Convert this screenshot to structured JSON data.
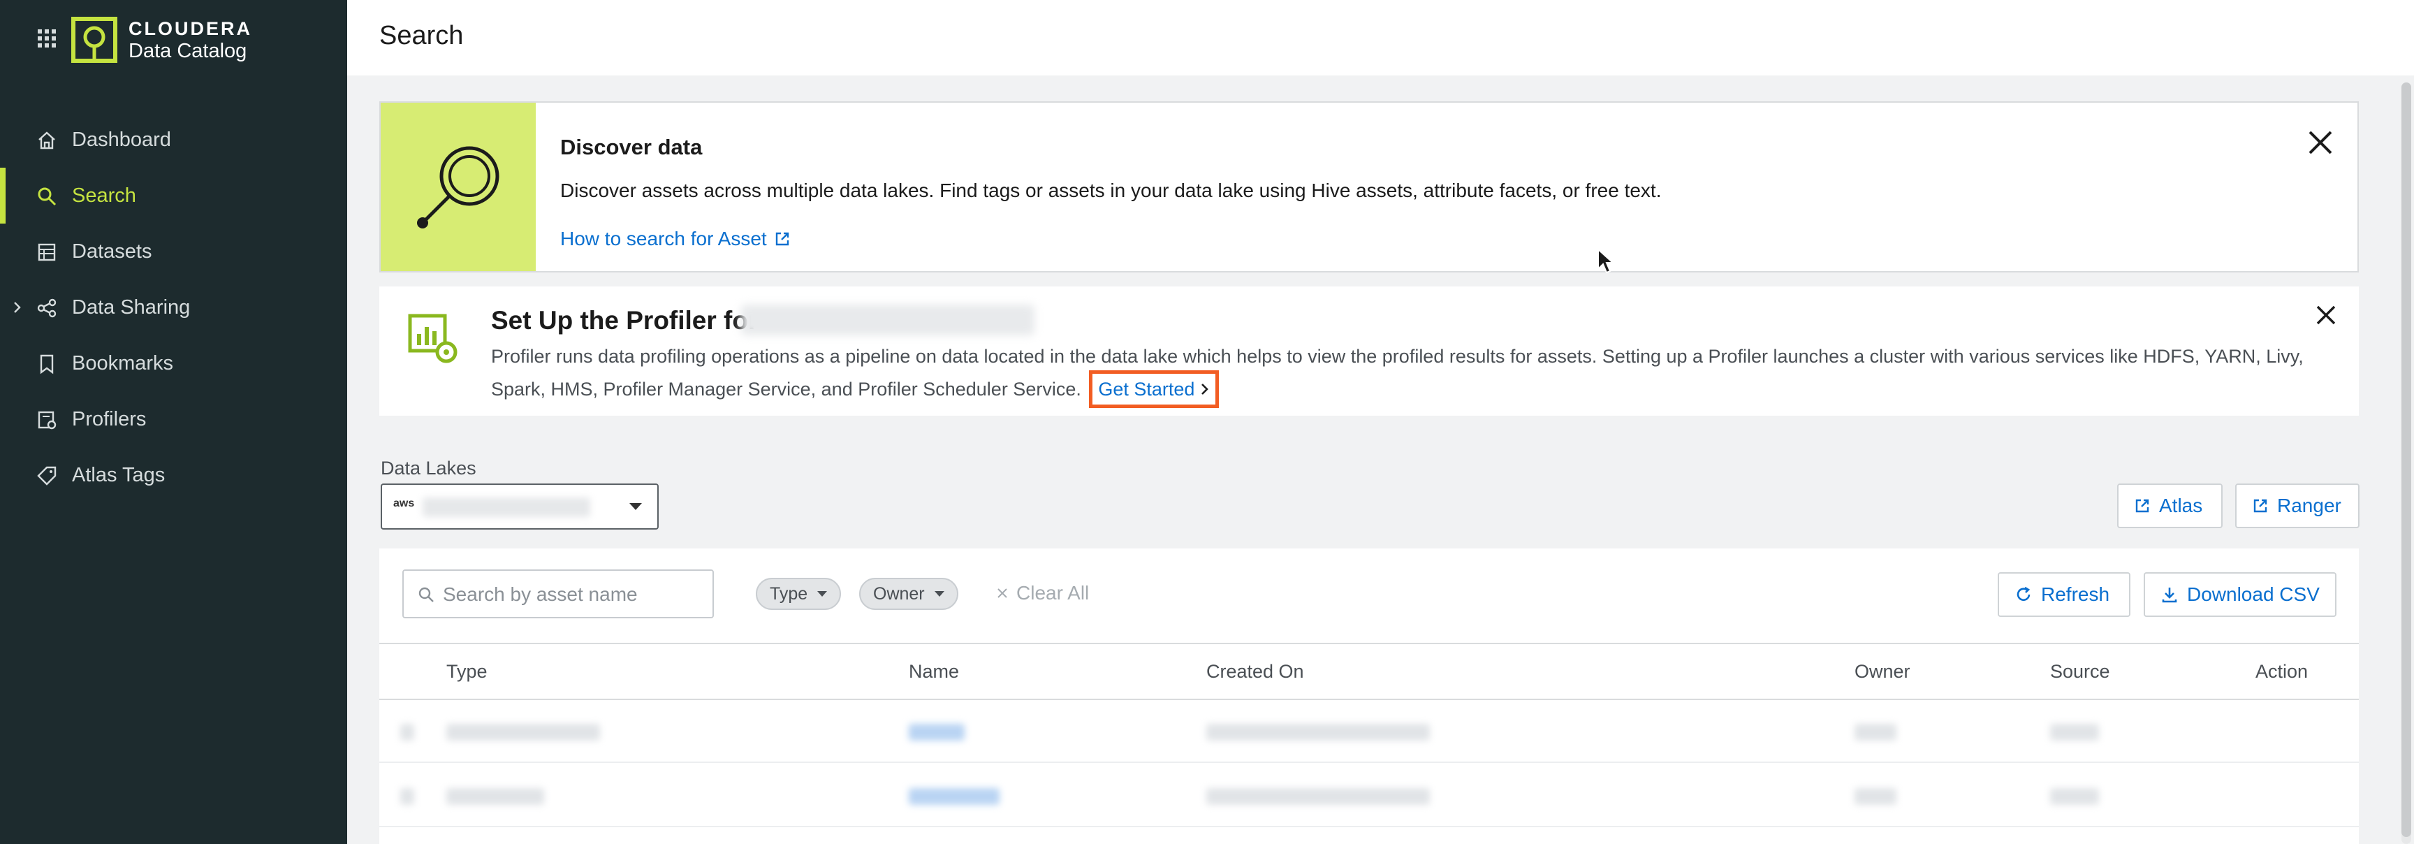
{
  "app": {
    "brand_name": "CLOUDERA",
    "brand_sub": "Data Catalog",
    "accent": "#c5e340",
    "sidebar_bg": "#1d2b2e",
    "link_color": "#0a6fcf",
    "highlight_color": "#f25d23"
  },
  "sidebar": {
    "items": [
      {
        "label": "Dashboard",
        "icon": "home-icon"
      },
      {
        "label": "Search",
        "icon": "search-icon"
      },
      {
        "label": "Datasets",
        "icon": "datasets-icon"
      },
      {
        "label": "Data Sharing",
        "icon": "share-icon"
      },
      {
        "label": "Bookmarks",
        "icon": "bookmark-icon"
      },
      {
        "label": "Profilers",
        "icon": "profilers-icon"
      },
      {
        "label": "Atlas Tags",
        "icon": "tag-icon"
      }
    ],
    "active": "Search"
  },
  "header": {
    "title": "Search"
  },
  "discover": {
    "title": "Discover data",
    "text": "Discover assets across multiple data lakes. Find tags or assets in your data lake using Hive assets, attribute facets, or free text.",
    "link": "How to search for Asset"
  },
  "profiler": {
    "title": "Set Up the Profiler for",
    "text": "Profiler runs data profiling operations as a pipeline on data located in the data lake which helps to view the profiled results for assets. Setting up a Profiler launches a cluster with various services like HDFS, YARN, Livy, Spark, HMS, Profiler Manager Service, and Profiler Scheduler Service.",
    "get_started": "Get Started"
  },
  "data_lakes": {
    "label": "Data Lakes",
    "provider": "aws"
  },
  "external": {
    "atlas": "Atlas",
    "ranger": "Ranger"
  },
  "toolbar": {
    "search_placeholder": "Search by asset name",
    "type_filter": "Type",
    "owner_filter": "Owner",
    "clear_all": "Clear All",
    "refresh": "Refresh",
    "download": "Download CSV"
  },
  "table": {
    "columns": [
      "Type",
      "Name",
      "Created On",
      "Owner",
      "Source",
      "Action"
    ]
  }
}
